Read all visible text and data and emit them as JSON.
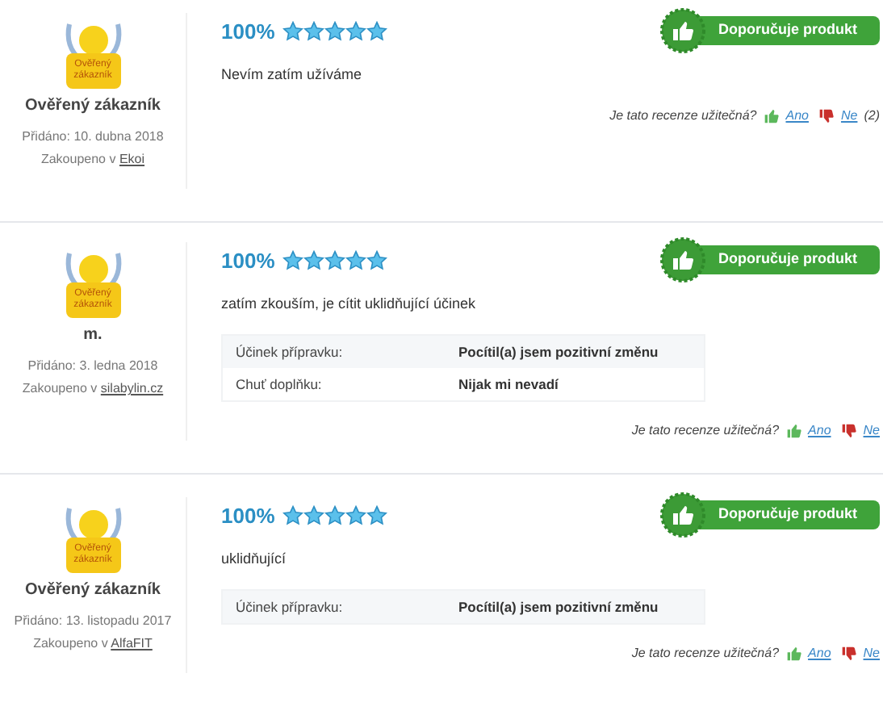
{
  "reviews": [
    {
      "badge_label": "Ověřený zákazník",
      "author": "Ověřený zákazník",
      "added": "Přidáno: 10. dubna 2018",
      "purchased_prefix": "Zakoupeno v",
      "shop": "Ekoi",
      "percent": "100%",
      "stars": 5,
      "recommend": "Doporučuje produkt",
      "text": "Nevím zatím užíváme",
      "helpful_question": "Je tato recenze užitečná?",
      "yes": "Ano",
      "no": "Ne",
      "no_count": "(2)"
    },
    {
      "badge_label": "Ověřený zákazník",
      "author": "m.",
      "added": "Přidáno: 3. ledna 2018",
      "purchased_prefix": "Zakoupeno v",
      "shop": "silabylin.cz",
      "percent": "100%",
      "stars": 5,
      "recommend": "Doporučuje produkt",
      "text": "zatím zkouším, je cítit uklidňující účinek",
      "attributes": [
        {
          "label": "Účinek přípravku:",
          "value": "Pocítil(a) jsem pozitivní změnu"
        },
        {
          "label": "Chuť doplňku:",
          "value": "Nijak mi nevadí"
        }
      ],
      "helpful_question": "Je tato recenze užitečná?",
      "yes": "Ano",
      "no": "Ne"
    },
    {
      "badge_label": "Ověřený zákazník",
      "author": "Ověřený zákazník",
      "added": "Přidáno: 13. listopadu 2017",
      "purchased_prefix": "Zakoupeno v",
      "shop": "AlfaFIT",
      "percent": "100%",
      "stars": 5,
      "recommend": "Doporučuje produkt",
      "text": "uklidňující",
      "attributes": [
        {
          "label": "Účinek přípravku:",
          "value": "Pocítil(a) jsem pozitivní změnu"
        }
      ],
      "helpful_question": "Je tato recenze užitečná?",
      "yes": "Ano",
      "no": "Ne"
    }
  ]
}
